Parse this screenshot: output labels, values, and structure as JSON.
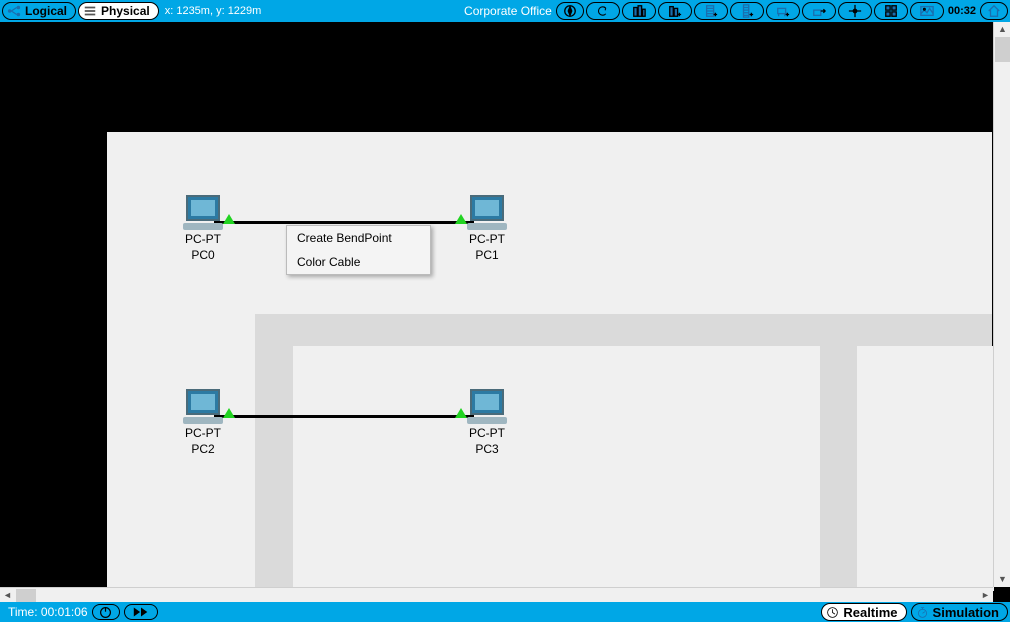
{
  "topbar": {
    "logical_label": "Logical",
    "physical_label": "Physical",
    "coords": "x: 1235m, y: 1229m",
    "location": "Corporate Office",
    "clock": "00:32"
  },
  "devices": {
    "pc0": {
      "type": "PC-PT",
      "name": "PC0"
    },
    "pc1": {
      "type": "PC-PT",
      "name": "PC1"
    },
    "pc2": {
      "type": "PC-PT",
      "name": "PC2"
    },
    "pc3": {
      "type": "PC-PT",
      "name": "PC3"
    }
  },
  "context_menu": {
    "item0": "Create BendPoint",
    "item1": "Color Cable"
  },
  "bottombar": {
    "time_label": "Time: 00:01:06",
    "realtime_label": "Realtime",
    "simulation_label": "Simulation"
  }
}
